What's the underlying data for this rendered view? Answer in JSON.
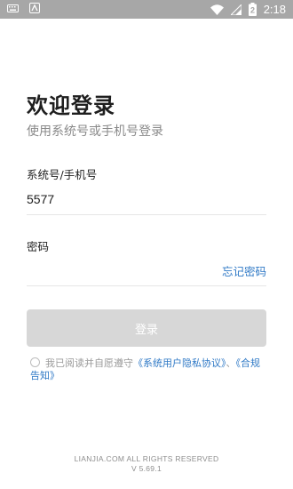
{
  "status_bar": {
    "left_icons": [
      "keyboard-icon",
      "app-notification-icon"
    ],
    "right_icons": [
      "wifi-icon",
      "signal-icon",
      "battery-icon"
    ],
    "battery_level": "2",
    "time": "2:18"
  },
  "login": {
    "title": "欢迎登录",
    "subtitle": "使用系统号或手机号登录",
    "account_label": "系统号/手机号",
    "account_value": "5577",
    "password_label": "密码",
    "password_value": "",
    "forgot_password": "忘记密码",
    "login_button": "登录",
    "agreement_prefix": "我已阅读并自愿遵守",
    "privacy_link": "《系统用户隐私协议》",
    "separator": "、",
    "compliance_link": "《合规告知》"
  },
  "footer": {
    "copyright": "LIANJIA.COM ALL RIGHTS RESERVED",
    "version": "V 5.69.1"
  },
  "colors": {
    "status_bar": "#a7a7a7",
    "accent": "#2f79c6",
    "button_disabled": "#d7d7d7"
  }
}
